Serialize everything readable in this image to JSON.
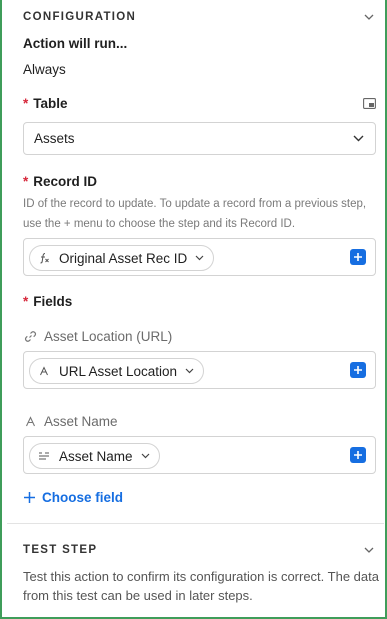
{
  "configuration": {
    "title": "CONFIGURATION",
    "action_label": "Action will run...",
    "action_value": "Always"
  },
  "table": {
    "label": "Table",
    "required_mark": "*",
    "selected": "Assets"
  },
  "record_id": {
    "label": "Record ID",
    "required_mark": "*",
    "help": "ID of the record to update. To update a record from a previous step, use the + menu to choose the step and its Record ID.",
    "token": "Original Asset Rec ID"
  },
  "fields": {
    "label": "Fields",
    "required_mark": "*",
    "items": [
      {
        "name": "Asset Location (URL)",
        "icon": "link-icon",
        "token": "URL Asset Location",
        "token_icon": "text-a-icon"
      },
      {
        "name": "Asset Name",
        "icon": "text-a-icon",
        "token": "Asset Name",
        "token_icon": "long-text-icon"
      }
    ],
    "choose_label": "Choose field"
  },
  "test_step": {
    "title": "TEST STEP",
    "description": "Test this action to confirm its configuration is correct. The data from this test can be used in later steps."
  },
  "colors": {
    "accent": "#166ee1",
    "required": "#d6273a",
    "frame": "#3f9d5a"
  }
}
